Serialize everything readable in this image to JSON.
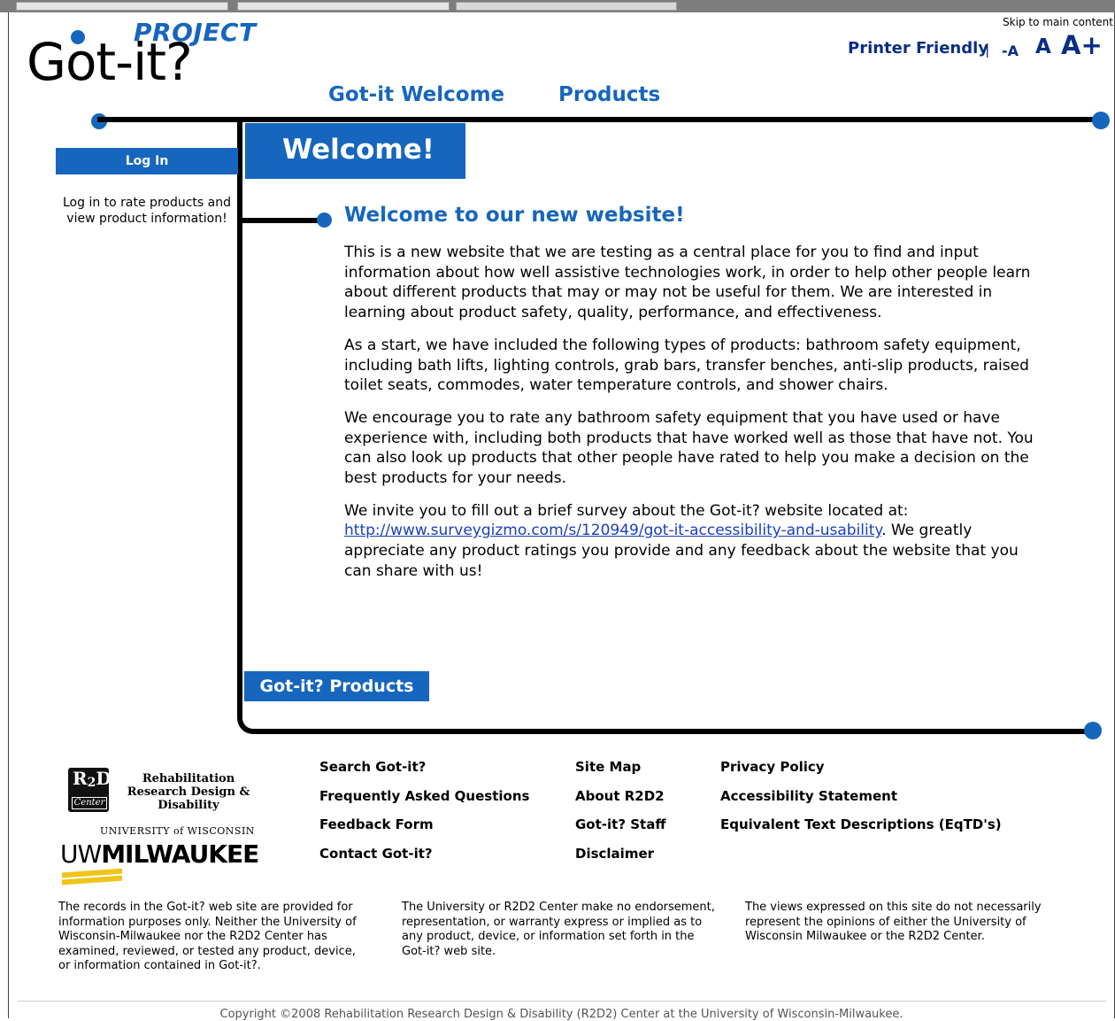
{
  "logo": {
    "project": "PROJECT",
    "name": "Got-it?"
  },
  "header": {
    "skip_link": "Skip to main content",
    "printer_friendly": "Printer Friendly",
    "separator": "|",
    "font_smaller": "-A",
    "font_normal": "A",
    "font_larger": "A+"
  },
  "nav": {
    "items": [
      {
        "label": "Got-it Welcome"
      },
      {
        "label": "Products"
      }
    ]
  },
  "sidebar": {
    "login_button": "Log In",
    "login_text": "Log in to rate products and view product information!"
  },
  "main": {
    "tab_title": "Welcome!",
    "heading": "Welcome to our new website!",
    "paragraphs": [
      "This is a new website that we are testing as a central place for you to find and input information about how well assistive technologies work, in order to help other people learn about different products that may or may not be useful for them. We are interested in learning about product safety, quality, performance, and effectiveness.",
      "As a start, we have included the following types of products: bathroom safety equipment, including bath lifts, lighting controls, grab bars, transfer benches, anti-slip products, raised toilet seats, commodes, water temperature controls, and shower chairs.",
      "We encourage you to rate any bathroom safety equipment that you have used or have experience with, including both products that have worked well as those that have not. You can also look up products that other people have rated to help you make a decision on the best products for your needs."
    ],
    "survey_intro": "We invite you to fill out a brief survey about the Got-it? website located at:",
    "survey_link": "http://www.surveygizmo.com/s/120949/got-it-accessibility-and-usability",
    "survey_outro": ". We greatly appreciate any product ratings you provide and any feedback about the website that you can share with us!",
    "products_tab": "Got-it? Products"
  },
  "footer": {
    "col1": [
      "Search Got-it?",
      "Frequently Asked Questions",
      "Feedback Form",
      "Contact Got-it?"
    ],
    "col2": [
      "Site Map",
      "About R2D2",
      "Got-it? Staff",
      "Disclaimer"
    ],
    "col3": [
      "Privacy Policy",
      "Accessibility Statement",
      "Equivalent Text Descriptions (EqTD's)"
    ],
    "rd_logo": {
      "line1": "R",
      "line2": "D",
      "sub1": "2",
      "sub2": "2",
      "center": "Center"
    },
    "rd_title": [
      "Rehabilitation",
      "Research Design &",
      "Disability"
    ],
    "uw_small": "UNIVERSITY of WISCONSIN",
    "uw_big_1": "UW",
    "uw_big_2": "MILWAUKEE",
    "disclaimer_left": "The records in the Got-it? web site are provided for information purposes only. Neither the University of Wisconsin-Milwaukee nor the R2D2 Center has examined, reviewed, or tested any product, device, or information contained in Got-it?.",
    "disclaimer_middle": "The University or R2D2 Center make no endorsement, representation, or warranty express or implied as to any product, device, or information set forth in the Got-it? web site.",
    "disclaimer_right": "The views expressed on this site do not necessarily represent the opinions of either the University of Wisconsin Milwaukee or the R2D2 Center.",
    "copyright": "Copyright ©2008 Rehabilitation Research Design & Disability (R2D2) Center at the University of Wisconsin-Milwaukee."
  },
  "colors": {
    "brand_blue": "#1666bd",
    "link_navy": "#0a2d84",
    "line": "#000000"
  }
}
